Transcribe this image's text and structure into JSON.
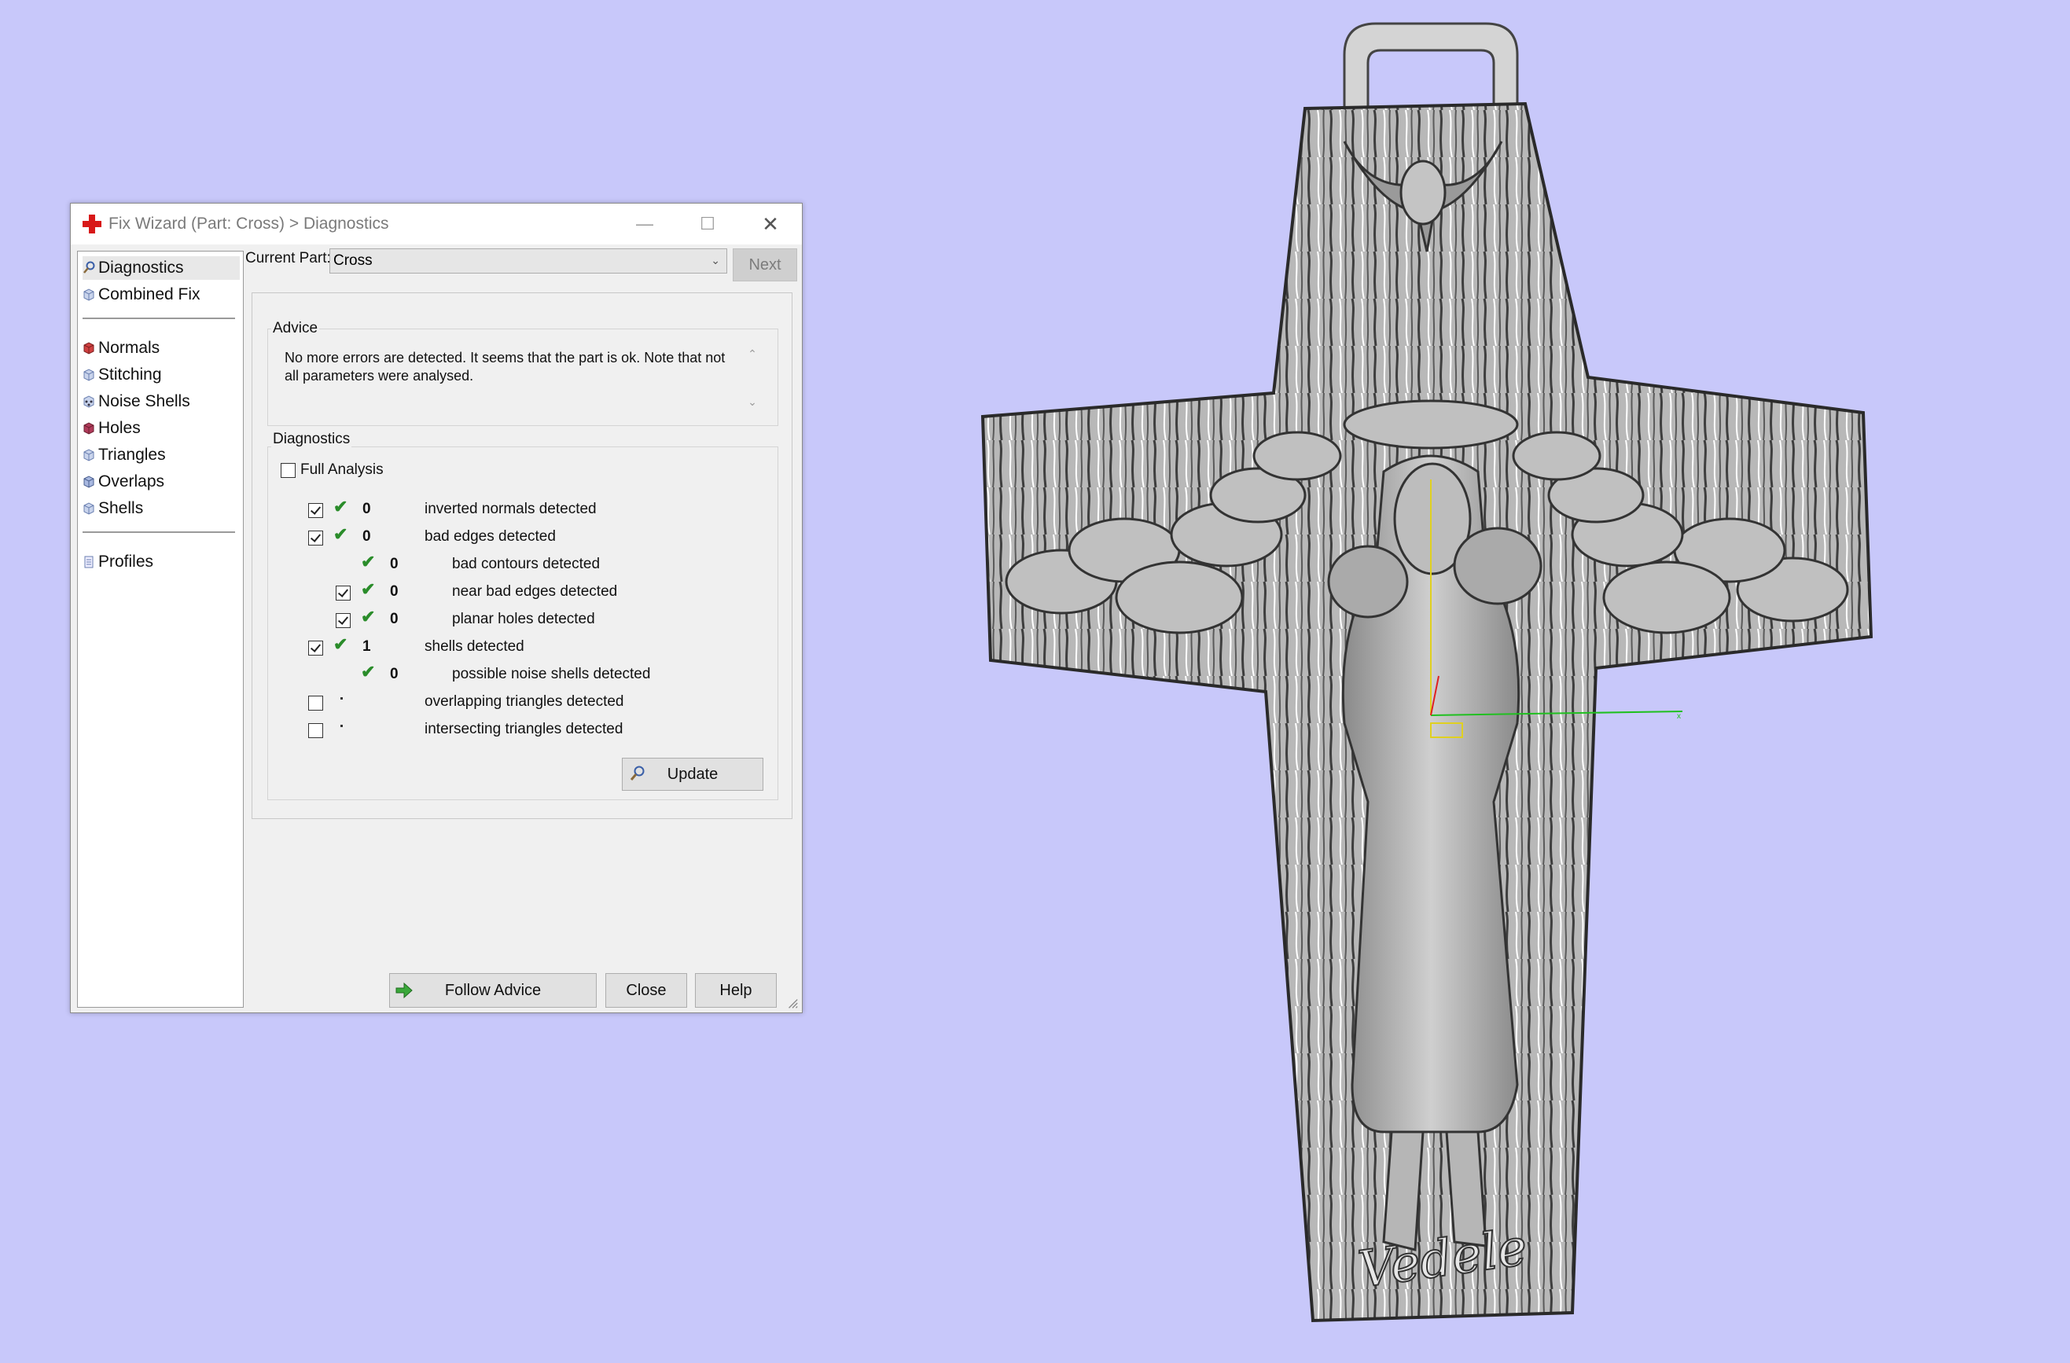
{
  "window": {
    "title": "Fix Wizard (Part: Cross) > Diagnostics",
    "minimize": "—",
    "maximize": "☐",
    "close": "✕"
  },
  "sidebar": {
    "items": [
      {
        "label": "Diagnostics",
        "icon": "magnifier-icon"
      },
      {
        "label": "Combined Fix",
        "icon": "cube-icon"
      },
      {
        "label": "Normals",
        "icon": "cube-red-icon"
      },
      {
        "label": "Stitching",
        "icon": "cube-icon"
      },
      {
        "label": "Noise Shells",
        "icon": "cube-dots-icon"
      },
      {
        "label": "Holes",
        "icon": "cube-red-icon"
      },
      {
        "label": "Triangles",
        "icon": "cube-icon"
      },
      {
        "label": "Overlaps",
        "icon": "cube-icon"
      },
      {
        "label": "Shells",
        "icon": "cube-icon"
      },
      {
        "label": "Profiles",
        "icon": "document-icon"
      }
    ],
    "selected": "Diagnostics"
  },
  "current_part": {
    "label": "Current Part:",
    "value": "Cross",
    "next_label": "Next"
  },
  "advice": {
    "title": "Advice",
    "text": "No more errors are detected. It seems that the part is ok. Note that not all parameters were analysed."
  },
  "diagnostics": {
    "title": "Diagnostics",
    "full_analysis_label": "Full Analysis",
    "rows": [
      {
        "checkbox": true,
        "checked": true,
        "status": "ok",
        "count": "0",
        "label": "inverted normals detected",
        "indent": 0
      },
      {
        "checkbox": true,
        "checked": true,
        "status": "ok",
        "count": "0",
        "label": "bad edges detected",
        "indent": 0
      },
      {
        "checkbox": false,
        "checked": false,
        "status": "ok",
        "count": "0",
        "label": "bad contours detected",
        "indent": 1
      },
      {
        "checkbox": true,
        "checked": true,
        "status": "ok",
        "count": "0",
        "label": "near bad edges detected",
        "indent": 1
      },
      {
        "checkbox": true,
        "checked": true,
        "status": "ok",
        "count": "0",
        "label": "planar holes detected",
        "indent": 1
      },
      {
        "checkbox": true,
        "checked": true,
        "status": "ok",
        "count": "1",
        "label": "shells detected",
        "indent": 0
      },
      {
        "checkbox": false,
        "checked": false,
        "status": "ok",
        "count": "0",
        "label": "possible noise shells detected",
        "indent": 1
      },
      {
        "checkbox": true,
        "checked": false,
        "status": "unknown",
        "count": "",
        "label": "overlapping triangles detected",
        "indent": 0
      },
      {
        "checkbox": true,
        "checked": false,
        "status": "unknown",
        "count": "",
        "label": "intersecting triangles detected",
        "indent": 0
      }
    ],
    "update_label": "Update"
  },
  "footer": {
    "follow_advice_label": "Follow Advice",
    "close_label": "Close",
    "help_label": "Help"
  },
  "model": {
    "engraving": "Vedele",
    "background_color": "#c8c8fa",
    "part_color": "#b0b0b0"
  }
}
